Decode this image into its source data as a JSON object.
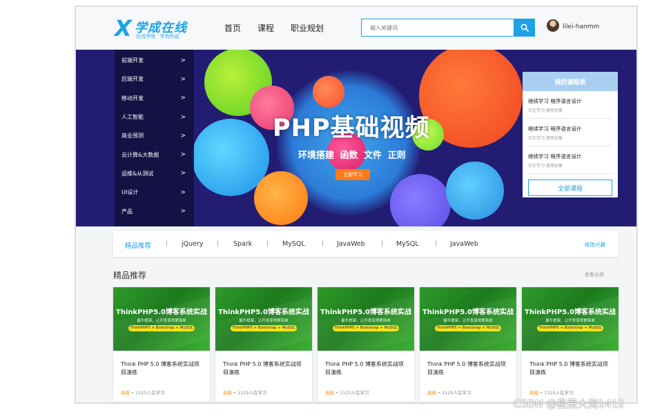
{
  "header": {
    "logo_mark": "X",
    "logo_name": "学成在线",
    "logo_slogan": "在线学院 · 学有所成",
    "nav": [
      "首页",
      "课程",
      "职业规划"
    ],
    "search_placeholder": "输入关键词",
    "user_name": "lilei-hanmm"
  },
  "banner": {
    "menu": [
      "前端开发",
      "后端开发",
      "移动开发",
      "人工智能",
      "商业预测",
      "云计算&大数据",
      "运维&从测试",
      "UI设计",
      "产品"
    ],
    "menu_arrow": ">",
    "title": "PHP基础视频",
    "subtitle": "环境搭建  函数  文件  正则",
    "button": "立即学习"
  },
  "my_courses": {
    "title": "我的课程表",
    "items": [
      {
        "title": "继续学习 程序语言设计",
        "status": "正在学习-使用对象"
      },
      {
        "title": "继续学习 程序语言设计",
        "status": "正在学习-使用对象"
      },
      {
        "title": "继续学习 程序语言设计",
        "status": "正在学习-使用对象"
      }
    ],
    "all_button": "全部课程"
  },
  "categories": {
    "items": [
      "精品推荐",
      "jQuery",
      "Spark",
      "MySQL",
      "JavaWeb",
      "MySQL",
      "JavaWeb"
    ],
    "separator": "|",
    "edit_label": "修改兴趣"
  },
  "section": {
    "title": "精品推荐",
    "view_all": "查看全部"
  },
  "cards": [
    {
      "img_title": "ThinkPHP5.0博客系统实战",
      "img_sub": "最牛框架，让开发变得更简单",
      "img_tag": "ThinkPHP5 + Bootstrap + MySQL",
      "name": "Think PHP 5.0 博客系统实战项目演练",
      "level": "高级",
      "learners": " • 1125人在学习"
    },
    {
      "img_title": "ThinkPHP5.0博客系统实战",
      "img_sub": "最牛框架，让开发变得更简单",
      "img_tag": "ThinkPHP5 + Bootstrap + MySQL",
      "name": "Think PHP 5.0 博客系统实战项目演练",
      "level": "高级",
      "learners": " • 1125人在学习"
    },
    {
      "img_title": "ThinkPHP5.0博客系统实战",
      "img_sub": "最牛框架，让开发变得更简单",
      "img_tag": "ThinkPHP5 + Bootstrap + MySQL",
      "name": "Think PHP 5.0 博客系统实战项目演练",
      "level": "高级",
      "learners": " • 1125人在学习"
    },
    {
      "img_title": "ThinkPHP5.0博客系统实战",
      "img_sub": "最牛框架，让开发变得更简单",
      "img_tag": "ThinkPHP5 + Bootstrap + MySQL",
      "name": "Think PHP 5.0 博客系统实战项目演练",
      "level": "高级",
      "learners": " • 1125人在学习"
    },
    {
      "img_title": "ThinkPHP5.0博客系统实战",
      "img_sub": "最牛框架，让开发变得更简单",
      "img_tag": "ThinkPHP5 + Bootstrap + MySQL",
      "name": "Think PHP 5.0 博客系统实战项目演练",
      "level": "高级",
      "learners": " • 1125人在学习"
    }
  ],
  "watermark": "CSDN @星辰大海1412",
  "colors": {
    "accent": "#1ea1e6",
    "banner_bg": "#221d73",
    "orange": "#ff7a18"
  }
}
